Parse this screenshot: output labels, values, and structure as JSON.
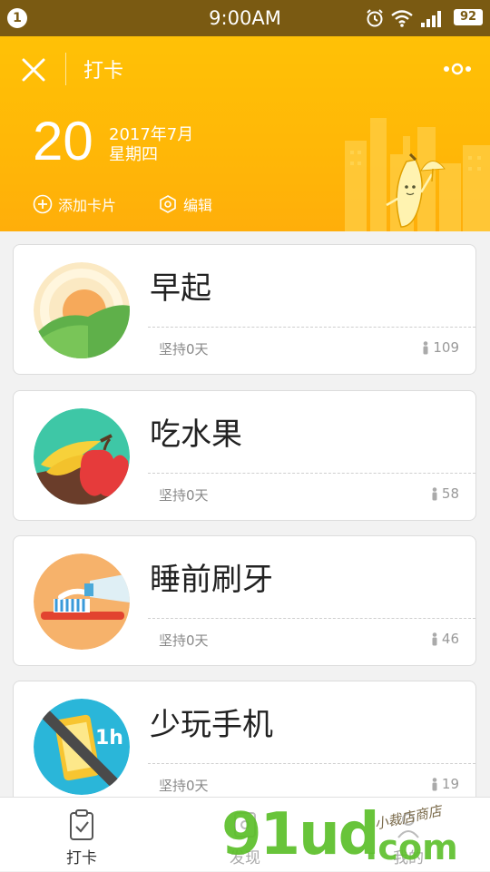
{
  "status_bar": {
    "notification": "1",
    "time": "9:00AM",
    "battery": "92"
  },
  "header": {
    "title": "打卡",
    "day": "20",
    "year_month": "2017年7月",
    "weekday": "星期四",
    "add_card_label": "添加卡片",
    "edit_label": "编辑",
    "accent_color": "#ffb707"
  },
  "cards": [
    {
      "name": "早起",
      "days": "坚持0天",
      "count": "109",
      "icon": "sunrise-illustration"
    },
    {
      "name": "吃水果",
      "days": "坚持0天",
      "count": "58",
      "icon": "fruit-illustration"
    },
    {
      "name": "睡前刷牙",
      "days": "坚持0天",
      "count": "46",
      "icon": "toothbrush-illustration"
    },
    {
      "name": "少玩手机",
      "days": "坚持0天",
      "count": "19",
      "icon": "no-phone-illustration"
    }
  ],
  "tabs": [
    {
      "label": "打卡",
      "icon": "clipboard-check-icon"
    },
    {
      "label": "发现",
      "icon": "discover-icon"
    },
    {
      "label": "我的",
      "icon": "profile-icon"
    }
  ],
  "watermark": {
    "main": "91ud",
    "suffix": ".com",
    "sub": "小裁店商店"
  }
}
